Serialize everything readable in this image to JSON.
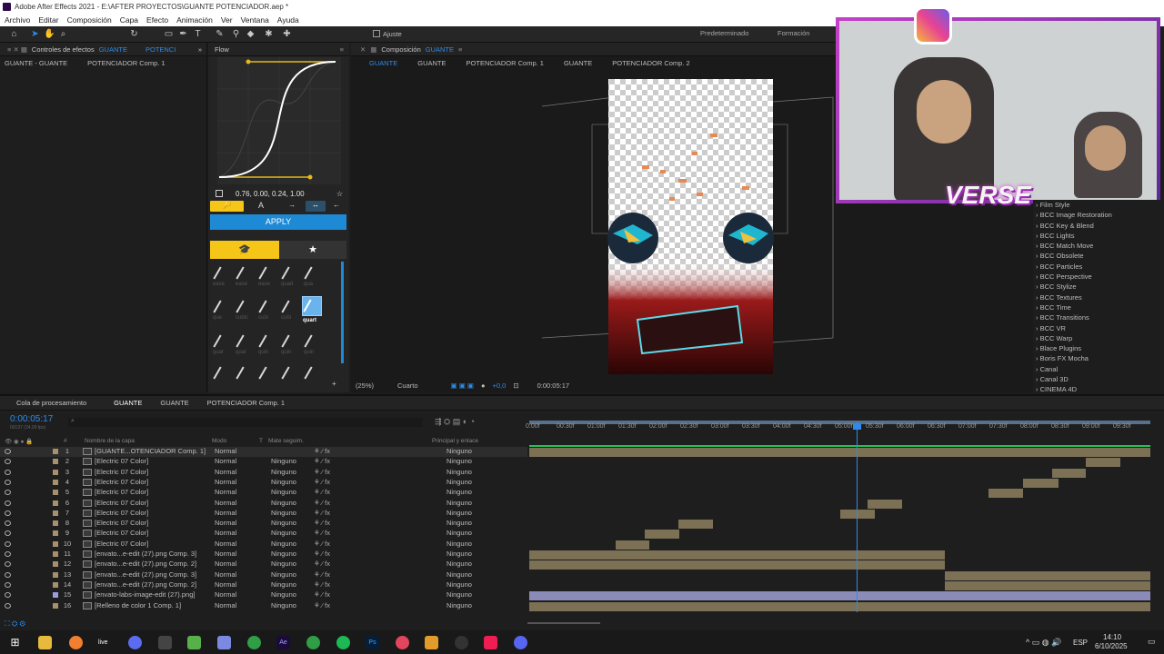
{
  "window": {
    "title": "Adobe After Effects 2021 - E:\\AFTER PROYECTOS\\GUANTE POTENCIADOR.aep *"
  },
  "menu": [
    "Archivo",
    "Editar",
    "Composición",
    "Capa",
    "Efecto",
    "Animación",
    "Ver",
    "Ventana",
    "Ayuda"
  ],
  "toolbar": {
    "snap_label": "Ajuste",
    "workspace_default": "Predeterminado",
    "workspace_training": "Formación"
  },
  "effects_panel": {
    "tab_label": "Controles de efectos",
    "tab_layer": "GUANTE",
    "tab_second": "POTENCI",
    "breadcrumb_comp": "GUANTE - GUANTE",
    "breadcrumb_layer": "POTENCIADOR Comp. 1"
  },
  "flow": {
    "tab_label": "Flow",
    "bezier_values": "0.76, 0.00, 0.24, 1.00",
    "apply_label": "APPLY",
    "selected_preset": "quart",
    "presets_row1": [
      "ease",
      "ease",
      "ease",
      "quad",
      "qua"
    ],
    "presets_row2": [
      "que",
      "cubic",
      "cubi",
      "cubi",
      "quart"
    ],
    "presets_row3": [
      "quar",
      "quar",
      "quin",
      "quin",
      "quin"
    ]
  },
  "composition": {
    "tab_label": "Composición",
    "comp_name": "GUANTE",
    "breadcrumbs": [
      "GUANTE",
      "GUANTE",
      "POTENCIADOR Comp. 1",
      "GUANTE",
      "POTENCIADOR Comp. 2"
    ],
    "zoom": "(25%)",
    "resolution": "Cuarto",
    "exposure": "+0,0",
    "timecode": "0:00:05:17"
  },
  "webcam": {
    "overlay_text": "VERSE"
  },
  "effects_list": [
    "Film Style",
    "BCC Image Restoration",
    "BCC Key & Blend",
    "BCC Lights",
    "BCC Match Move",
    "BCC Obsolete",
    "BCC Particles",
    "BCC Perspective",
    "BCC Stylize",
    "BCC Textures",
    "BCC Time",
    "BCC Transitions",
    "BCC VR",
    "BCC Warp",
    "Blace Plugins",
    "Boris FX Mocha",
    "Canal",
    "Canal 3D",
    "CINEMA 4D"
  ],
  "timeline": {
    "tabs": [
      "Cola de procesamiento",
      "GUANTE",
      "GUANTE",
      "POTENCIADOR Comp. 1"
    ],
    "current_time": "0:00:05:17",
    "fps_info": "00137 (24.00 fps)",
    "headers": {
      "number": "#",
      "layer_name": "Nombre de la capa",
      "mode": "Modo",
      "t": "T",
      "matte": "Mate seguim.",
      "parent": "Principal y enlace"
    },
    "ruler": [
      "0:00f",
      "00:30f",
      "01:00f",
      "01:30f",
      "02:00f",
      "02:30f",
      "03:00f",
      "03:30f",
      "04:00f",
      "04:30f",
      "05:00f",
      "05:30f",
      "06:00f",
      "06:30f",
      "07:00f",
      "07:30f",
      "08:00f",
      "08:30f",
      "09:00f",
      "09:30f"
    ],
    "layers": [
      {
        "num": "1",
        "name": "[GUANTE...OTENCIADOR Comp. 1]",
        "mode": "Normal",
        "matte": "",
        "parent": "Ninguno"
      },
      {
        "num": "2",
        "name": "[Electric 07 Color]",
        "mode": "Normal",
        "matte": "Ninguno",
        "parent": "Ninguno"
      },
      {
        "num": "3",
        "name": "[Electric 07 Color]",
        "mode": "Normal",
        "matte": "Ninguno",
        "parent": "Ninguno"
      },
      {
        "num": "4",
        "name": "[Electric 07 Color]",
        "mode": "Normal",
        "matte": "Ninguno",
        "parent": "Ninguno"
      },
      {
        "num": "5",
        "name": "[Electric 07 Color]",
        "mode": "Normal",
        "matte": "Ninguno",
        "parent": "Ninguno"
      },
      {
        "num": "6",
        "name": "[Electric 07 Color]",
        "mode": "Normal",
        "matte": "Ninguno",
        "parent": "Ninguno"
      },
      {
        "num": "7",
        "name": "[Electric 07 Color]",
        "mode": "Normal",
        "matte": "Ninguno",
        "parent": "Ninguno"
      },
      {
        "num": "8",
        "name": "[Electric 07 Color]",
        "mode": "Normal",
        "matte": "Ninguno",
        "parent": "Ninguno"
      },
      {
        "num": "9",
        "name": "[Electric 07 Color]",
        "mode": "Normal",
        "matte": "Ninguno",
        "parent": "Ninguno"
      },
      {
        "num": "10",
        "name": "[Electric 07 Color]",
        "mode": "Normal",
        "matte": "Ninguno",
        "parent": "Ninguno"
      },
      {
        "num": "11",
        "name": "[envato...e-edit (27).png Comp. 3]",
        "mode": "Normal",
        "matte": "Ninguno",
        "parent": "Ninguno"
      },
      {
        "num": "12",
        "name": "[envato...e-edit (27).png Comp. 2]",
        "mode": "Normal",
        "matte": "Ninguno",
        "parent": "Ninguno"
      },
      {
        "num": "13",
        "name": "[envato...e-edit (27).png Comp. 3]",
        "mode": "Normal",
        "matte": "Ninguno",
        "parent": "Ninguno"
      },
      {
        "num": "14",
        "name": "[envato...e-edit (27).png Comp. 2]",
        "mode": "Normal",
        "matte": "Ninguno",
        "parent": "Ninguno"
      },
      {
        "num": "15",
        "name": "[envato-labs-image-edit (27).png]",
        "mode": "Normal",
        "matte": "Ninguno",
        "parent": "Ninguno"
      },
      {
        "num": "16",
        "name": "[Relleno de color 1 Comp. 1]",
        "mode": "Normal",
        "matte": "Ninguno",
        "parent": "Ninguno"
      }
    ]
  },
  "taskbar": {
    "language": "ESP",
    "time": "14:10",
    "date": "6/10/2025"
  },
  "colors": {
    "accent_blue": "#2d8ceb",
    "flow_yellow": "#f5c518",
    "apply_blue": "#1e8ad6",
    "clip_tan": "#7c7055"
  }
}
